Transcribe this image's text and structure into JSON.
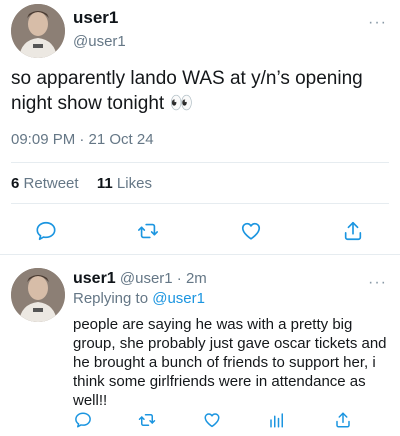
{
  "main_tweet": {
    "display_name": "user1",
    "handle": "@user1",
    "text": "so apparently lando WAS at y/n’s opening night show tonight 👀",
    "timestamp": "09:09 PM · 21 Oct 24",
    "retweet_count": "6",
    "retweet_label": "Retweet",
    "like_count": "11",
    "like_label": "Likes",
    "more_label": "···"
  },
  "reply": {
    "display_name": "user1",
    "meta": "@user1 · 2m",
    "replying_prefix": "Replying to",
    "replying_handle": "@user1",
    "text": "people are saying he was with a pretty big group, she probably just gave oscar tickets and he brought a bunch of friends to support her, i think some girlfriends were in attendance as well!!",
    "more_label": "···"
  },
  "icons": {
    "reply": "reply-icon",
    "retweet": "retweet-icon",
    "like": "heart-icon",
    "share": "share-icon",
    "analytics": "analytics-icon"
  },
  "colors": {
    "accent": "#1b95e0",
    "muted": "#657786",
    "icon": "#1b95e0",
    "divider": "#e6ecf0"
  }
}
